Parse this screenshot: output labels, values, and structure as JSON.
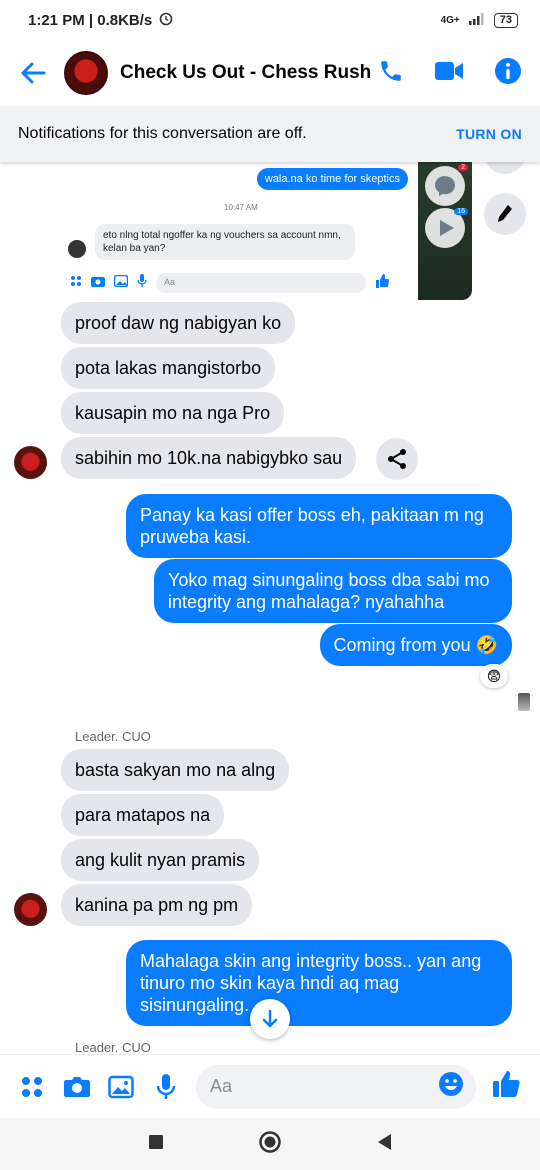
{
  "status_bar": {
    "time_speed": "1:21 PM | 0.8KB/s",
    "network": "4G+",
    "battery": "73"
  },
  "header": {
    "title": "Check Us Out - Chess Rush"
  },
  "banner": {
    "text": "Notifications for this conversation are off.",
    "action": "TURN ON"
  },
  "embedded_screenshot": {
    "sent_message": "wala.na ko time for skeptics",
    "timestamp": "10:47 AM",
    "received_message": "eto nlng total ngoffer ka ng vouchers sa account nmn, kelan ba yan?",
    "input_placeholder": "Aa",
    "badge_1": "2",
    "badge_2": "16"
  },
  "messages_group1": [
    "proof daw ng nabigyan ko",
    "pota lakas mangistorbo",
    "kausapin mo na nga Pro",
    "sabihin mo 10k.na nabigybko sau"
  ],
  "outgoing_group1": [
    "Panay ka kasi offer boss eh, pakitaan m ng pruweba kasi.",
    "Yoko mag sinungaling boss dba sabi mo integrity ang mahalaga? nyahahha",
    "Coming from you 🤣"
  ],
  "reaction": "😨",
  "sender_label": "Leader. CUO",
  "messages_group2": [
    "basta sakyan mo na alng",
    "para matapos na",
    "ang kulit nyan pramis",
    "kanina pa pm ng pm"
  ],
  "outgoing_group2": [
    "Mahalaga skin ang integrity boss.. yan ang tinuro mo skin kaya hndi aq mag sisinungaling."
  ],
  "sender_label_2": "Leader. CUO",
  "composer": {
    "placeholder": "Aa"
  },
  "colors": {
    "accent": "#0a7cff",
    "incoming_bubble": "#e4e6eb"
  }
}
